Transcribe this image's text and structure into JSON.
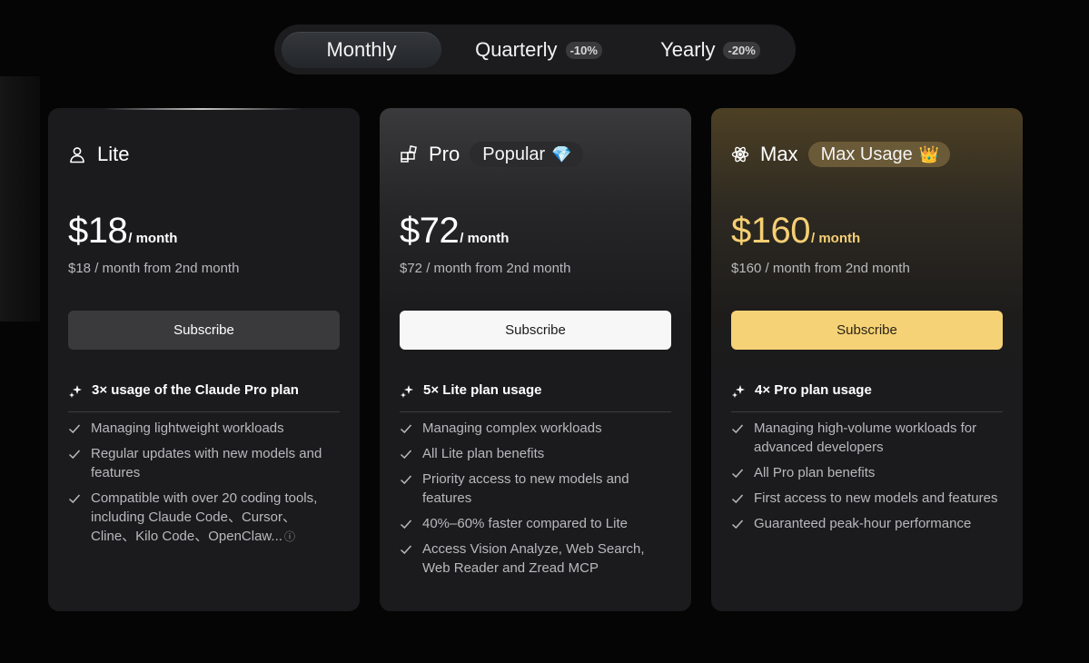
{
  "billing": {
    "options": [
      {
        "label": "Monthly",
        "active": true
      },
      {
        "label": "Quarterly",
        "discount": "-10%"
      },
      {
        "label": "Yearly",
        "discount": "-20%"
      }
    ]
  },
  "plans": [
    {
      "name": "Lite",
      "icon": "user-icon",
      "price": "$18",
      "per": "/ month",
      "price_note": "$18 / month from 2nd month",
      "subscribe_label": "Subscribe",
      "feature_header": "3× usage of the Claude Pro plan",
      "features": [
        "Managing lightweight workloads",
        "Regular updates with new models and features",
        "Compatible with over 20 coding tools, including Claude Code、Cursor、Cline、Kilo Code、OpenClaw..."
      ]
    },
    {
      "name": "Pro",
      "icon": "blocks-icon",
      "badge": "Popular",
      "badge_emoji": "💎",
      "price": "$72",
      "per": "/ month",
      "price_note": "$72 / month from 2nd month",
      "subscribe_label": "Subscribe",
      "feature_header": "5× Lite plan usage",
      "features": [
        "Managing complex workloads",
        "All Lite plan benefits",
        "Priority access to new models and features",
        "40%–60% faster compared to Lite",
        "Access Vision Analyze, Web Search, Web Reader and Zread MCP"
      ]
    },
    {
      "name": "Max",
      "icon": "atom-icon",
      "badge": "Max Usage",
      "badge_emoji": "👑",
      "price": "$160",
      "per": "/ month",
      "price_note": "$160 / month from 2nd month",
      "subscribe_label": "Subscribe",
      "feature_header": "4× Pro plan usage",
      "features": [
        "Managing high-volume workloads for advanced developers",
        "All Pro plan benefits",
        "First access to new models and features",
        "Guaranteed peak-hour performance"
      ]
    }
  ],
  "colors": {
    "background": "#050505",
    "card": "#1b1b1d",
    "gold_accent": "#f6cf73",
    "gold_button": "#f6d276",
    "muted_text": "#b9b9bd"
  }
}
